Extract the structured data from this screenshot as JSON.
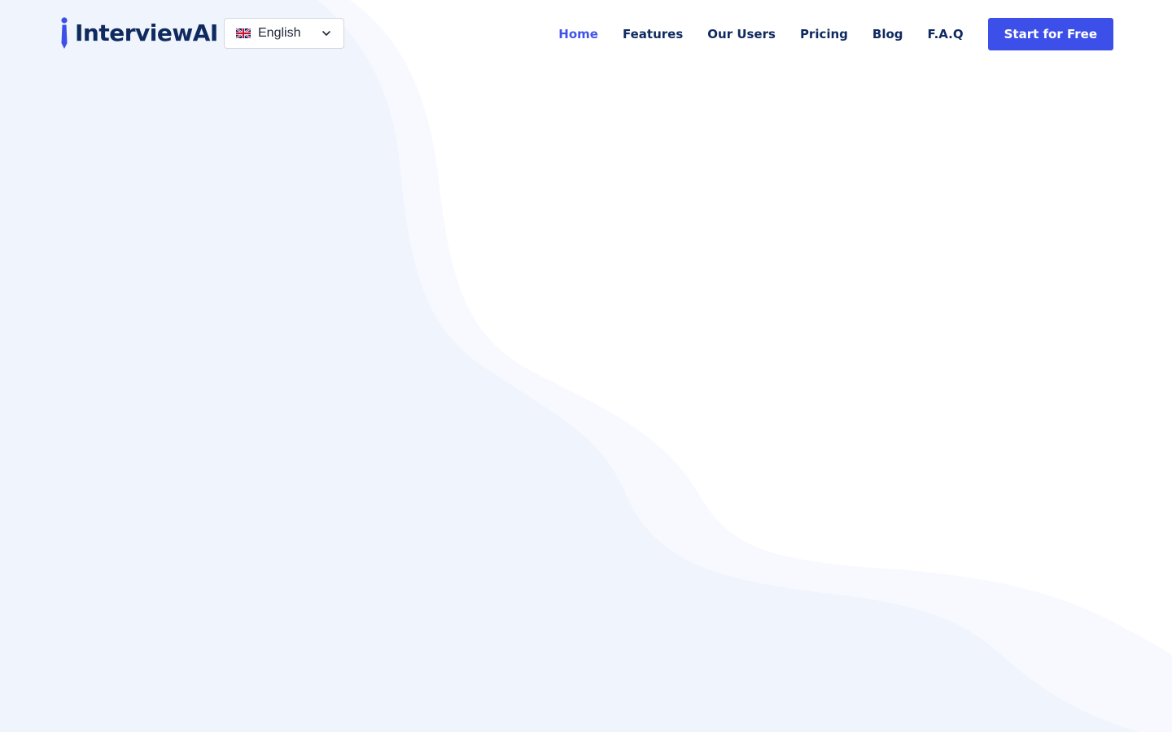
{
  "brand": {
    "name": "InterviewAI",
    "accent_color": "#3d4fe9",
    "text_color": "#0f2a5f"
  },
  "language_selector": {
    "flag_icon": "uk-flag-icon",
    "selected": "English",
    "chevron_icon": "chevron-down-icon"
  },
  "nav": {
    "items": [
      {
        "label": "Home",
        "active": true
      },
      {
        "label": "Features",
        "active": false
      },
      {
        "label": "Our Users",
        "active": false
      },
      {
        "label": "Pricing",
        "active": false
      },
      {
        "label": "Blog",
        "active": false
      },
      {
        "label": "F.A.Q",
        "active": false
      }
    ],
    "cta_label": "Start for Free"
  },
  "background": {
    "wave_color_light": "#f7f9fe",
    "wave_color": "#eff4fd"
  }
}
